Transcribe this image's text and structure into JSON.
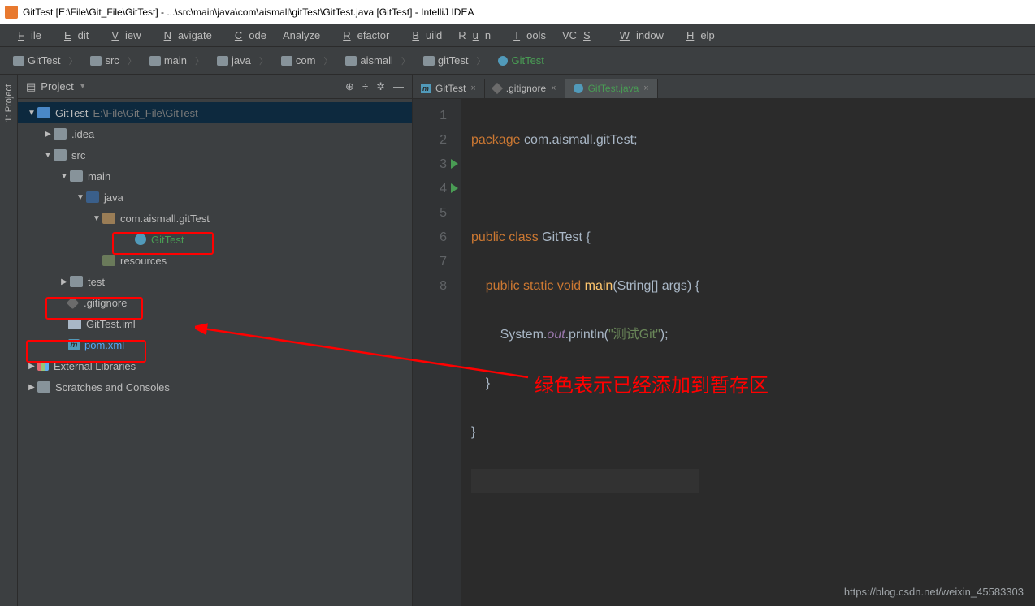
{
  "window": {
    "title": "GitTest [E:\\File\\Git_File\\GitTest] - ...\\src\\main\\java\\com\\aismall\\gitTest\\GitTest.java [GitTest] - IntelliJ IDEA"
  },
  "menu": {
    "file": "File",
    "edit": "Edit",
    "view": "View",
    "navigate": "Navigate",
    "code": "Code",
    "analyze": "Analyze",
    "refactor": "Refactor",
    "build": "Build",
    "run": "Run",
    "tools": "Tools",
    "vcs": "VCS",
    "window": "Window",
    "help": "Help"
  },
  "breadcrumbs": [
    "GitTest",
    "src",
    "main",
    "java",
    "com",
    "aismall",
    "gitTest",
    "GitTest"
  ],
  "leftStrip": {
    "project": "1: Project"
  },
  "sidebar": {
    "title": "Project",
    "actions": {
      "target": "⊕",
      "collapse": "÷",
      "settings": "✲",
      "hide": "—"
    }
  },
  "tree": {
    "root": {
      "name": "GitTest",
      "path": "E:\\File\\Git_File\\GitTest"
    },
    "idea": ".idea",
    "src": "src",
    "main": "main",
    "java": "java",
    "pkg": "com.aismall.gitTest",
    "gitTestClass": "GitTest",
    "resources": "resources",
    "test": "test",
    "gitignore": ".gitignore",
    "iml": "GitTest.iml",
    "pom": "pom.xml",
    "extLib": "External Libraries",
    "scratches": "Scratches and Consoles"
  },
  "tabs": [
    {
      "label": "GitTest",
      "type": "maven",
      "active": false
    },
    {
      "label": ".gitignore",
      "type": "gitignore",
      "active": false
    },
    {
      "label": "GitTest.java",
      "type": "java",
      "active": true,
      "green": true
    }
  ],
  "code": {
    "l1a": "package ",
    "l1b": "com.aismall.gitTest;",
    "l3a": "public class ",
    "l3b": "GitTest ",
    "l3c": "{",
    "l4a": "    public static void ",
    "l4b": "main",
    "l4c": "(String[] args) {",
    "l5a": "        System.",
    "l5b": "out",
    "l5c": ".println(",
    "l5d": "\"测试Git\"",
    "l5e": ");",
    "l6": "    }",
    "l7": "}"
  },
  "annotation": {
    "text": "绿色表示已经添加到暂存区"
  },
  "watermark": "https://blog.csdn.net/weixin_45583303"
}
